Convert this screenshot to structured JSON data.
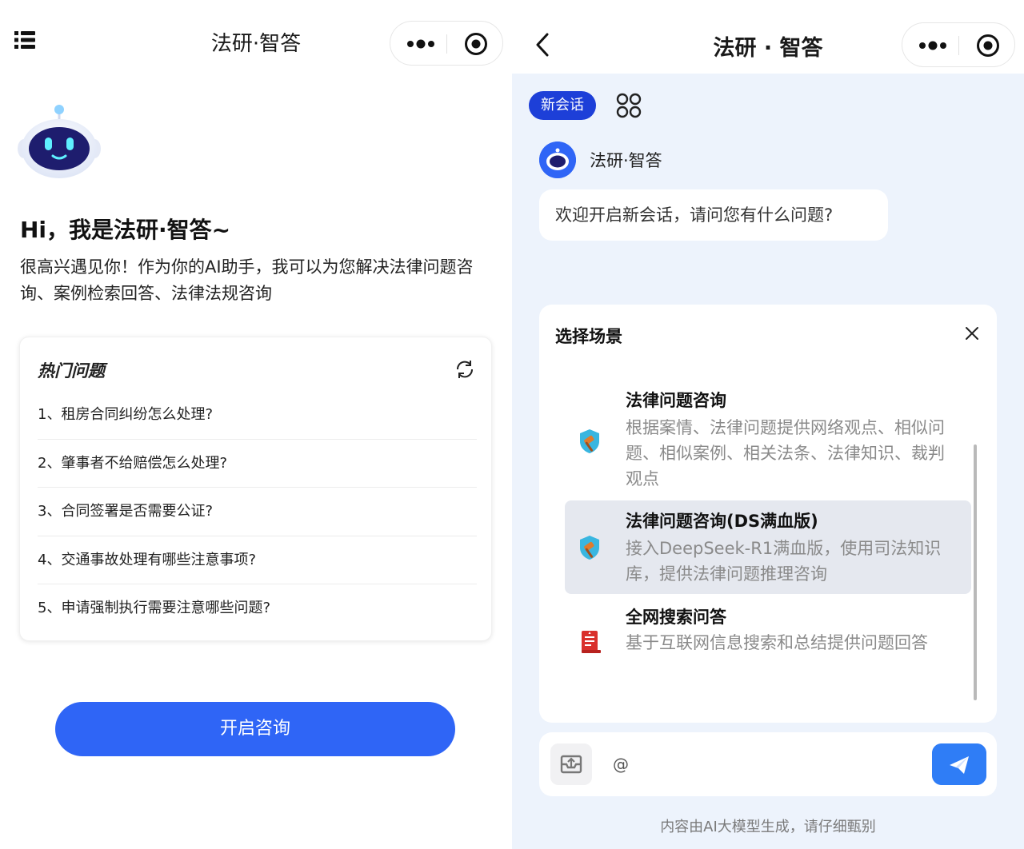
{
  "left": {
    "nav": {
      "title": "法研·智答"
    },
    "greeting": "Hi，我是法研·智答~",
    "intro": "很高兴遇见你！作为你的AI助手，我可以为您解决法律问题咨询、案例检索回答、法律法规咨询",
    "hot": {
      "title": "热门问题",
      "questions": [
        "1、租房合同纠纷怎么处理?",
        "2、肇事者不给赔偿怎么处理?",
        "3、合同签署是否需要公证?",
        "4、交通事故处理有哪些注意事项?",
        "5、申请强制执行需要注意哪些问题?"
      ]
    },
    "start_button": "开启咨询"
  },
  "right": {
    "nav": {
      "title": "法研 · 智答"
    },
    "new_chat_tab": "新会话",
    "bot_name": "法研·智答",
    "welcome": "欢迎开启新会话，请问您有什么问题?",
    "scene": {
      "title": "选择场景",
      "items": [
        {
          "name": "法律问题咨询",
          "desc": "根据案情、法律问题提供网络观点、相似问题、相似案例、相关法条、法律知识、裁判观点",
          "icon": "gavel-shield-icon",
          "selected": false
        },
        {
          "name": "法律问题咨询(DS满血版)",
          "desc": "接入DeepSeek-R1满血版，使用司法知识库，提供法律问题推理咨询",
          "icon": "gavel-shield-icon",
          "selected": true
        },
        {
          "name": "全网搜索问答",
          "desc": "基于互联网信息搜索和总结提供问题回答",
          "icon": "red-document-icon",
          "selected": false
        }
      ]
    },
    "input": {
      "value": "@"
    },
    "disclaimer": "内容由AI大模型生成，请仔细甄别"
  },
  "colors": {
    "primary": "#2f65f6",
    "tab_bg": "#1d3fd8",
    "right_bg": "#edf3fc",
    "send": "#2f7df6"
  }
}
